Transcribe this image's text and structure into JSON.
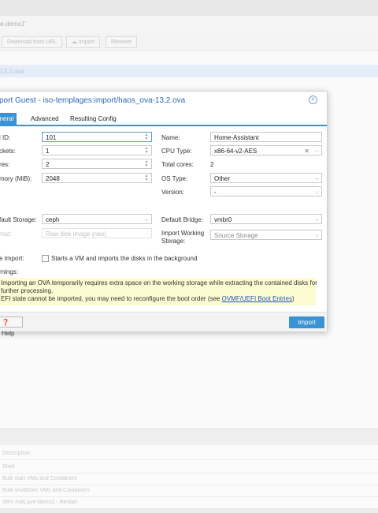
{
  "background": {
    "node_title": "e-demo1'",
    "toolbar": {
      "download_label": "Download from URL",
      "import_label": "Import",
      "remove_label": "Remove"
    },
    "selected_row": "13.2.ova",
    "tasks": {
      "header": "Description",
      "rows": [
        "Shell",
        "Bulk start VMs and Containers",
        "Bulk shutdown VMs and Containers",
        "SRV mds.pve-demo2 - Restart"
      ]
    }
  },
  "dialog": {
    "title": "port Guest - iso-templages:import/haos_ova-13.2.ova",
    "tabs": [
      "eneral",
      "Advanced",
      "Resulting Config"
    ],
    "left": {
      "vmid_label": "l ID:",
      "vmid_value": "101",
      "sockets_label": "ckets:",
      "sockets_value": "1",
      "cores_label": "res:",
      "cores_value": "2",
      "memory_label": "mory (MiB):",
      "memory_value": "2048",
      "storage_label": "fault Storage:",
      "storage_value": "ceph",
      "format_label": "mat:",
      "format_value": "Raw disk image (raw)",
      "live_import_label": "e Import:",
      "live_import_text": "Starts a VM and imports the disks in the background",
      "warnings_label": "rnings:"
    },
    "right": {
      "name_label": "Name:",
      "name_value": "Home-Assistant",
      "cpu_label": "CPU Type:",
      "cpu_value": "x86-64-v2-AES",
      "total_cores_label": "Total cores:",
      "total_cores_value": "2",
      "ostype_label": "OS Type:",
      "ostype_value": "Other",
      "version_label": "Version:",
      "version_value": "-",
      "bridge_label": "Default Bridge:",
      "bridge_value": "vmbr0",
      "working_storage_label_1": "Import Working",
      "working_storage_label_2": "Storage:",
      "working_storage_placeholder": "Source Storage"
    },
    "warnings": {
      "line1": "Importing an OVA temporarily requires extra space on the working storage while extracting the contained disks for",
      "line2": "further processing.",
      "line3_pre": "EFI state cannot be imported, you may need to reconfigure the boot order (see ",
      "line3_link": "OVMF/UEFI Boot Entries",
      "line3_post": ")"
    },
    "footer": {
      "help_label": "Help",
      "import_label": "Import"
    }
  }
}
